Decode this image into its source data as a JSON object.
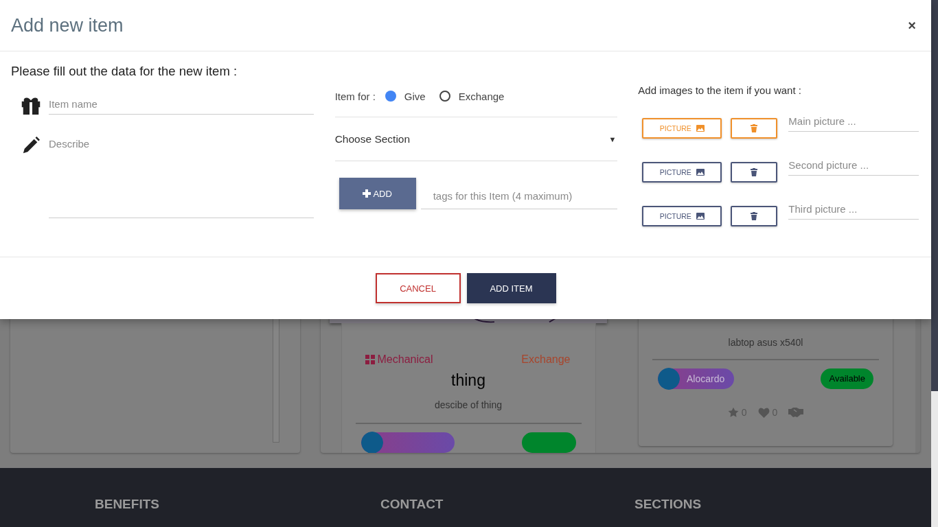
{
  "modal": {
    "title": "Add new item",
    "close": "×",
    "intro": "Please fill out the data for the new item :",
    "fields": [
      {
        "kind": "input",
        "placeholder": "Item name"
      },
      {
        "kind": "textarea",
        "placeholder": "Describe"
      }
    ],
    "item_for": {
      "label": "Item for :",
      "options": [
        {
          "label": "Give",
          "selected": true
        },
        {
          "label": "Exchange",
          "selected": false
        }
      ]
    },
    "section_select": {
      "value": "Choose Section",
      "caret": "▼"
    },
    "tags": {
      "button": "ADD",
      "placeholder": "tags for this Item (4 maximum)"
    },
    "images": {
      "label": "Add images to the item if you want :",
      "rows": [
        {
          "button": "PICTURE",
          "placeholder": "Main picture ...",
          "active": true
        },
        {
          "button": "PICTURE",
          "placeholder": "Second picture ...",
          "active": false
        },
        {
          "button": "PICTURE",
          "placeholder": "Third picture ...",
          "active": false
        }
      ]
    },
    "buttons": [
      {
        "label": "CANCEL",
        "kind": "secondary"
      },
      {
        "label": "ADD ITEM",
        "kind": "primary"
      }
    ]
  },
  "background": {
    "cards": [
      {
        "kind": "picture-card",
        "category": "Mechanical",
        "type": "Exchange",
        "title": "thing",
        "description": "descibe of thing"
      },
      {
        "kind": "text-card",
        "description": "labtop asus x540l",
        "user": "Alocardo",
        "status": "Available",
        "stars_count": "0",
        "likes_count": "0"
      }
    ]
  },
  "footer": {
    "headings": [
      "BENEFITS",
      "CONTACT",
      "SECTIONS"
    ]
  }
}
